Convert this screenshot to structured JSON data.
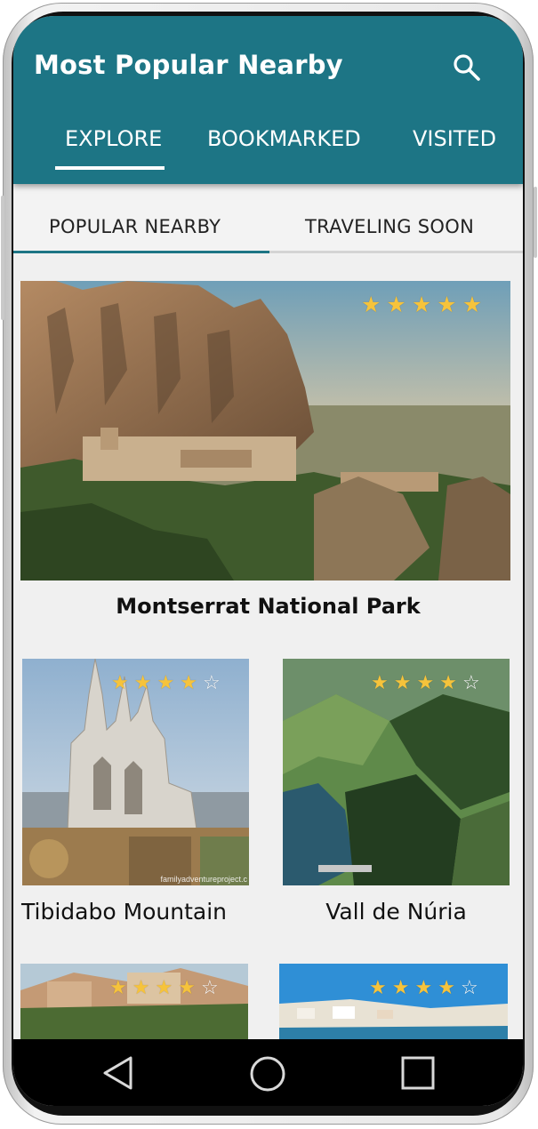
{
  "app": {
    "title": "Most Popular Nearby"
  },
  "tabs": [
    {
      "label": "EXPLORE",
      "active": true
    },
    {
      "label": "BOOKMARKED",
      "active": false
    },
    {
      "label": "VISITED",
      "active": false
    }
  ],
  "subtabs": [
    {
      "label": "POPULAR NEARBY",
      "active": true
    },
    {
      "label": "TRAVELING SOON",
      "active": false
    }
  ],
  "places": [
    {
      "name": "Montserrat National Park",
      "rating": 5,
      "max_rating": 5
    },
    {
      "name": "Tibidabo Mountain",
      "rating": 4,
      "max_rating": 5
    },
    {
      "name": "Vall de Núria",
      "rating": 4,
      "max_rating": 5
    },
    {
      "name": "",
      "rating": 4,
      "max_rating": 5
    },
    {
      "name": "",
      "rating": 4,
      "max_rating": 5
    }
  ],
  "watermark": "familyadventureproject.c",
  "icons": {
    "search": "search-icon",
    "nav_back": "back-triangle-icon",
    "nav_home": "home-circle-icon",
    "nav_recents": "recents-square-icon"
  },
  "colors": {
    "appbar": "#1d7585",
    "accent": "#1d7585",
    "star_filled": "#f6c33b",
    "background": "#f0f0f0"
  }
}
